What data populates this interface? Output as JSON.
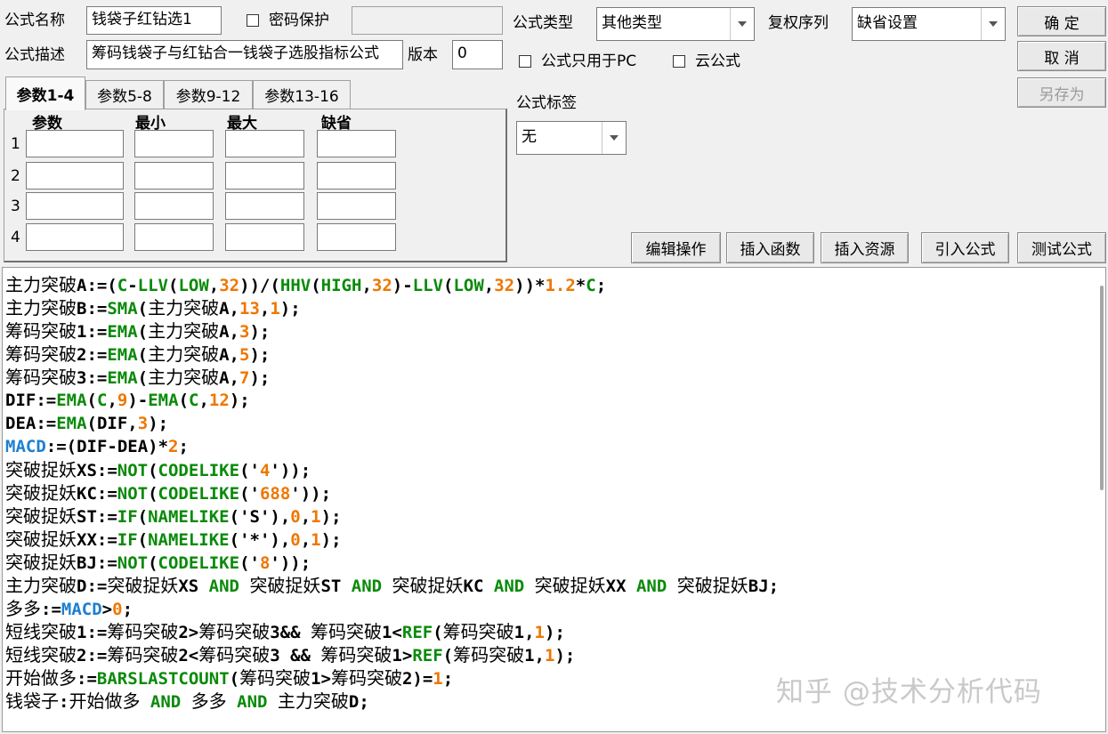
{
  "form": {
    "name_label": "公式名称",
    "name_value": "钱袋子红钻选1",
    "password_label": "密码保护",
    "password_value": "",
    "desc_label": "公式描述",
    "desc_value": "筹码钱袋子与红钻合一钱袋子选股指标公式",
    "version_label": "版本",
    "version_value": "0",
    "type_label": "公式类型",
    "type_value": "其他类型",
    "rights_label": "复权序列",
    "rights_value": "缺省设置",
    "pc_only_label": "公式只用于PC",
    "cloud_label": "云公式",
    "tag_label": "公式标签",
    "tag_value": "无"
  },
  "buttons": {
    "ok": "确 定",
    "cancel": "取 消",
    "save_as": "另存为",
    "edit_ops": "编辑操作",
    "insert_func": "插入函数",
    "insert_resource": "插入资源",
    "import_formula": "引入公式",
    "test_formula": "测试公式"
  },
  "params": {
    "tabs": [
      "参数1-4",
      "参数5-8",
      "参数9-12",
      "参数13-16"
    ],
    "active_tab": 0,
    "columns": [
      "参数",
      "最小",
      "最大",
      "缺省"
    ],
    "rows": [
      "1",
      "2",
      "3",
      "4"
    ]
  },
  "code_lines": [
    [
      [
        "c",
        "主力突破"
      ],
      [
        "t",
        "A:=("
      ],
      [
        "f",
        "C"
      ],
      [
        "t",
        "-"
      ],
      [
        "f",
        "LLV"
      ],
      [
        "t",
        "("
      ],
      [
        "f",
        "LOW"
      ],
      [
        "t",
        ","
      ],
      [
        "n",
        "32"
      ],
      [
        "t",
        "))/("
      ],
      [
        "f",
        "HHV"
      ],
      [
        "t",
        "("
      ],
      [
        "f",
        "HIGH"
      ],
      [
        "t",
        ","
      ],
      [
        "n",
        "32"
      ],
      [
        "t",
        ")-"
      ],
      [
        "f",
        "LLV"
      ],
      [
        "t",
        "("
      ],
      [
        "f",
        "LOW"
      ],
      [
        "t",
        ","
      ],
      [
        "n",
        "32"
      ],
      [
        "t",
        "))*"
      ],
      [
        "n",
        "1.2"
      ],
      [
        "t",
        "*"
      ],
      [
        "f",
        "C"
      ],
      [
        "t",
        ";"
      ]
    ],
    [
      [
        "c",
        "主力突破"
      ],
      [
        "t",
        "B:="
      ],
      [
        "f",
        "SMA"
      ],
      [
        "t",
        "("
      ],
      [
        "c",
        "主力突破"
      ],
      [
        "t",
        "A,"
      ],
      [
        "n",
        "13"
      ],
      [
        "t",
        ","
      ],
      [
        "n",
        "1"
      ],
      [
        "t",
        ");"
      ]
    ],
    [
      [
        "c",
        "筹码突破"
      ],
      [
        "t",
        "1:="
      ],
      [
        "f",
        "EMA"
      ],
      [
        "t",
        "("
      ],
      [
        "c",
        "主力突破"
      ],
      [
        "t",
        "A,"
      ],
      [
        "n",
        "3"
      ],
      [
        "t",
        ");"
      ]
    ],
    [
      [
        "c",
        "筹码突破"
      ],
      [
        "t",
        "2:="
      ],
      [
        "f",
        "EMA"
      ],
      [
        "t",
        "("
      ],
      [
        "c",
        "主力突破"
      ],
      [
        "t",
        "A,"
      ],
      [
        "n",
        "5"
      ],
      [
        "t",
        ");"
      ]
    ],
    [
      [
        "c",
        "筹码突破"
      ],
      [
        "t",
        "3:="
      ],
      [
        "f",
        "EMA"
      ],
      [
        "t",
        "("
      ],
      [
        "c",
        "主力突破"
      ],
      [
        "t",
        "A,"
      ],
      [
        "n",
        "7"
      ],
      [
        "t",
        ");"
      ]
    ],
    [
      [
        "t",
        "DIF:="
      ],
      [
        "f",
        "EMA"
      ],
      [
        "t",
        "("
      ],
      [
        "f",
        "C"
      ],
      [
        "t",
        ","
      ],
      [
        "n",
        "9"
      ],
      [
        "t",
        ")-"
      ],
      [
        "f",
        "EMA"
      ],
      [
        "t",
        "("
      ],
      [
        "f",
        "C"
      ],
      [
        "t",
        ","
      ],
      [
        "n",
        "12"
      ],
      [
        "t",
        ");"
      ]
    ],
    [
      [
        "t",
        "DEA:="
      ],
      [
        "f",
        "EMA"
      ],
      [
        "t",
        "(DIF,"
      ],
      [
        "n",
        "3"
      ],
      [
        "t",
        ");"
      ]
    ],
    [
      [
        "b",
        "MACD"
      ],
      [
        "t",
        ":=(DIF-DEA)*"
      ],
      [
        "n",
        "2"
      ],
      [
        "t",
        ";"
      ]
    ],
    [
      [
        "c",
        "突破捉妖"
      ],
      [
        "t",
        "XS:="
      ],
      [
        "f",
        "NOT"
      ],
      [
        "t",
        "("
      ],
      [
        "f",
        "CODELIKE"
      ],
      [
        "t",
        "('"
      ],
      [
        "n",
        "4"
      ],
      [
        "t",
        "'));"
      ]
    ],
    [
      [
        "c",
        "突破捉妖"
      ],
      [
        "t",
        "KC:="
      ],
      [
        "f",
        "NOT"
      ],
      [
        "t",
        "("
      ],
      [
        "f",
        "CODELIKE"
      ],
      [
        "t",
        "('"
      ],
      [
        "n",
        "688"
      ],
      [
        "t",
        "'));"
      ]
    ],
    [
      [
        "c",
        "突破捉妖"
      ],
      [
        "t",
        "ST:="
      ],
      [
        "f",
        "IF"
      ],
      [
        "t",
        "("
      ],
      [
        "f",
        "NAMELIKE"
      ],
      [
        "t",
        "('S'),"
      ],
      [
        "n",
        "0"
      ],
      [
        "t",
        ","
      ],
      [
        "n",
        "1"
      ],
      [
        "t",
        ");"
      ]
    ],
    [
      [
        "c",
        "突破捉妖"
      ],
      [
        "t",
        "XX:="
      ],
      [
        "f",
        "IF"
      ],
      [
        "t",
        "("
      ],
      [
        "f",
        "NAMELIKE"
      ],
      [
        "t",
        "('*'),"
      ],
      [
        "n",
        "0"
      ],
      [
        "t",
        ","
      ],
      [
        "n",
        "1"
      ],
      [
        "t",
        ");"
      ]
    ],
    [
      [
        "c",
        "突破捉妖"
      ],
      [
        "t",
        "BJ:="
      ],
      [
        "f",
        "NOT"
      ],
      [
        "t",
        "("
      ],
      [
        "f",
        "CODELIKE"
      ],
      [
        "t",
        "('"
      ],
      [
        "n",
        "8"
      ],
      [
        "t",
        "'));"
      ]
    ],
    [
      [
        "c",
        "主力突破"
      ],
      [
        "t",
        "D:="
      ],
      [
        "c",
        "突破捉妖"
      ],
      [
        "t",
        "XS "
      ],
      [
        "f",
        "AND"
      ],
      [
        "t",
        " "
      ],
      [
        "c",
        "突破捉妖"
      ],
      [
        "t",
        "ST "
      ],
      [
        "f",
        "AND"
      ],
      [
        "t",
        " "
      ],
      [
        "c",
        "突破捉妖"
      ],
      [
        "t",
        "KC "
      ],
      [
        "f",
        "AND"
      ],
      [
        "t",
        " "
      ],
      [
        "c",
        "突破捉妖"
      ],
      [
        "t",
        "XX "
      ],
      [
        "f",
        "AND"
      ],
      [
        "t",
        " "
      ],
      [
        "c",
        "突破捉妖"
      ],
      [
        "t",
        "BJ;"
      ]
    ],
    [
      [
        "c",
        "多多"
      ],
      [
        "t",
        ":="
      ],
      [
        "b",
        "MACD"
      ],
      [
        "t",
        ">"
      ],
      [
        "n",
        "0"
      ],
      [
        "t",
        ";"
      ]
    ],
    [
      [
        "c",
        "短线突破"
      ],
      [
        "t",
        "1:="
      ],
      [
        "c",
        "筹码突破"
      ],
      [
        "t",
        "2>"
      ],
      [
        "c",
        "筹码突破"
      ],
      [
        "t",
        "3&& "
      ],
      [
        "c",
        "筹码突破"
      ],
      [
        "t",
        "1<"
      ],
      [
        "f",
        "REF"
      ],
      [
        "t",
        "("
      ],
      [
        "c",
        "筹码突破"
      ],
      [
        "t",
        "1,"
      ],
      [
        "n",
        "1"
      ],
      [
        "t",
        ");"
      ]
    ],
    [
      [
        "c",
        "短线突破"
      ],
      [
        "t",
        "2:="
      ],
      [
        "c",
        "筹码突破"
      ],
      [
        "t",
        "2<"
      ],
      [
        "c",
        "筹码突破"
      ],
      [
        "t",
        "3 && "
      ],
      [
        "c",
        "筹码突破"
      ],
      [
        "t",
        "1>"
      ],
      [
        "f",
        "REF"
      ],
      [
        "t",
        "("
      ],
      [
        "c",
        "筹码突破"
      ],
      [
        "t",
        "1,"
      ],
      [
        "n",
        "1"
      ],
      [
        "t",
        ");"
      ]
    ],
    [
      [
        "c",
        "开始做多"
      ],
      [
        "t",
        ":="
      ],
      [
        "f",
        "BARSLASTCOUNT"
      ],
      [
        "t",
        "("
      ],
      [
        "c",
        "筹码突破"
      ],
      [
        "t",
        "1>"
      ],
      [
        "c",
        "筹码突破"
      ],
      [
        "t",
        "2)="
      ],
      [
        "n",
        "1"
      ],
      [
        "t",
        ";"
      ]
    ],
    [
      [
        "c",
        "钱袋子"
      ],
      [
        "t",
        ":"
      ],
      [
        "c",
        "开始做多"
      ],
      [
        "t",
        " "
      ],
      [
        "f",
        "AND"
      ],
      [
        "t",
        " "
      ],
      [
        "c",
        "多多"
      ],
      [
        "t",
        " "
      ],
      [
        "f",
        "AND"
      ],
      [
        "t",
        " "
      ],
      [
        "c",
        "主力突破"
      ],
      [
        "t",
        "D;"
      ]
    ]
  ],
  "watermark": "知乎 @技术分析代码"
}
